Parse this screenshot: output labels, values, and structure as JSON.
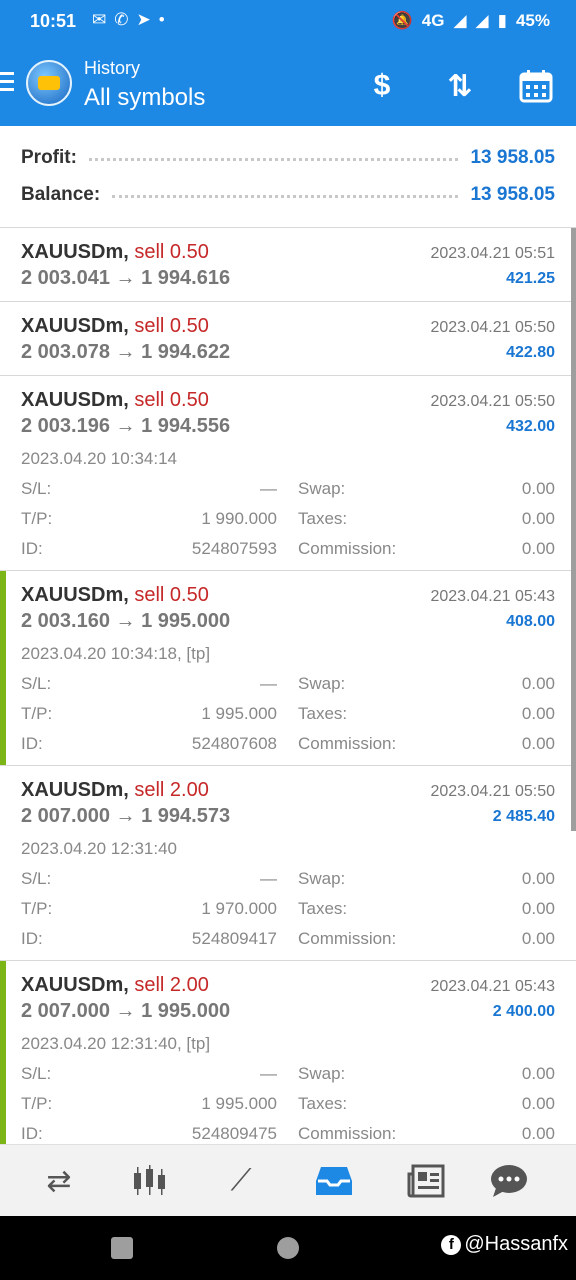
{
  "status_bar": {
    "time": "10:51",
    "network": "4G",
    "battery": "45%",
    "notification_icons": [
      "messenger-icon",
      "whatsapp-icon",
      "telegram-icon",
      "dot-icon"
    ]
  },
  "app_bar": {
    "subtitle": "History",
    "title": "All symbols",
    "accent_color": "#1e88e5"
  },
  "summary": {
    "profit_label": "Profit:",
    "profit_value": "13 958.05",
    "balance_label": "Balance:",
    "balance_value": "13 958.05"
  },
  "deals": [
    {
      "symbol": "XAUUSDm,",
      "action": "sell 0.50",
      "prices": "2 003.041 → 1 994.616",
      "close_time": "2023.04.21 05:51",
      "profit": "421.25"
    },
    {
      "symbol": "XAUUSDm,",
      "action": "sell 0.50",
      "prices": "2 003.078 → 1 994.622",
      "close_time": "2023.04.21 05:50",
      "profit": "422.80"
    },
    {
      "symbol": "XAUUSDm,",
      "action": "sell 0.50",
      "prices": "2 003.196 → 1 994.556",
      "close_time": "2023.04.21 05:50",
      "profit": "432.00",
      "open_time": "2023.04.20 10:34:14",
      "sl_label": "S/L:",
      "sl": "—",
      "swap_label": "Swap:",
      "swap": "0.00",
      "tp_label": "T/P:",
      "tp": "1 990.000",
      "taxes_label": "Taxes:",
      "taxes": "0.00",
      "id_label": "ID:",
      "id": "524807593",
      "commission_label": "Commission:",
      "commission": "0.00"
    },
    {
      "symbol": "XAUUSDm,",
      "action": "sell 0.50",
      "prices": "2 003.160 → 1 995.000",
      "close_time": "2023.04.21 05:43",
      "profit": "408.00",
      "open_time": "2023.04.20 10:34:18, [tp]",
      "sl_label": "S/L:",
      "sl": "—",
      "swap_label": "Swap:",
      "swap": "0.00",
      "tp_label": "T/P:",
      "tp": "1 995.000",
      "taxes_label": "Taxes:",
      "taxes": "0.00",
      "id_label": "ID:",
      "id": "524807608",
      "commission_label": "Commission:",
      "commission": "0.00"
    },
    {
      "symbol": "XAUUSDm,",
      "action": "sell 2.00",
      "prices": "2 007.000 → 1 994.573",
      "close_time": "2023.04.21 05:50",
      "profit": "2 485.40",
      "open_time": "2023.04.20 12:31:40",
      "sl_label": "S/L:",
      "sl": "—",
      "swap_label": "Swap:",
      "swap": "0.00",
      "tp_label": "T/P:",
      "tp": "1 970.000",
      "taxes_label": "Taxes:",
      "taxes": "0.00",
      "id_label": "ID:",
      "id": "524809417",
      "commission_label": "Commission:",
      "commission": "0.00"
    },
    {
      "symbol": "XAUUSDm,",
      "action": "sell 2.00",
      "prices": "2 007.000 → 1 995.000",
      "close_time": "2023.04.21 05:43",
      "profit": "2 400.00",
      "open_time": "2023.04.20 12:31:40, [tp]",
      "sl_label": "S/L:",
      "sl": "—",
      "swap_label": "Swap:",
      "swap": "0.00",
      "tp_label": "T/P:",
      "tp": "1 995.000",
      "taxes_label": "Taxes:",
      "taxes": "0.00",
      "id_label": "ID:",
      "id": "524809475",
      "commission_label": "Commission:",
      "commission": "0.00"
    }
  ],
  "bottom_nav": [
    "quotes-icon",
    "chart-icon",
    "trade-icon",
    "history-icon",
    "news-icon",
    "chat-icon"
  ],
  "watermark": "@Hassanfx"
}
